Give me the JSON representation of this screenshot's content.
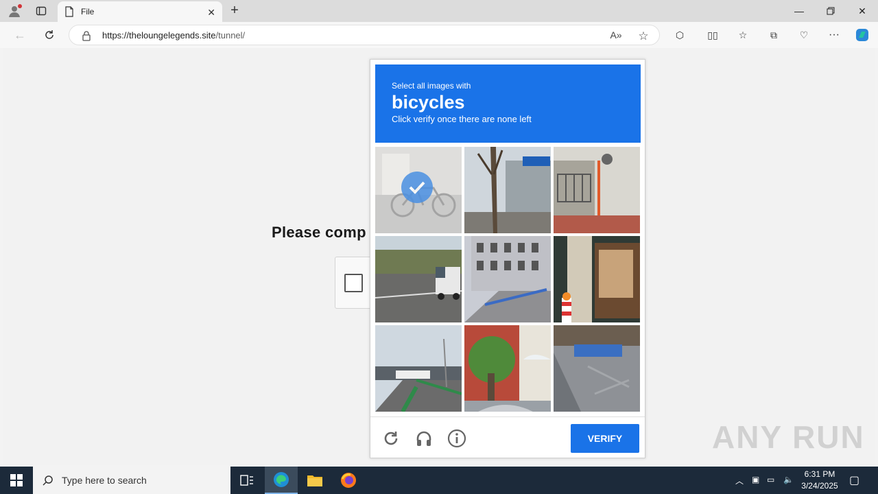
{
  "browser": {
    "tab_title": "File",
    "url_domain": "https://theloungelegends.site",
    "url_path": "/tunnel/"
  },
  "page": {
    "prompt_text": "Please comp"
  },
  "captcha": {
    "line1": "Select all images with",
    "target": "bicycles",
    "line3": "Click verify once there are none left",
    "verify_label": "VERIFY",
    "tiles": [
      {
        "scene": "bicycle",
        "selected": true
      },
      {
        "scene": "street-tree-awning",
        "selected": false
      },
      {
        "scene": "building-railing",
        "selected": false
      },
      {
        "scene": "highway-truck",
        "selected": false
      },
      {
        "scene": "building-facade",
        "selected": false
      },
      {
        "scene": "shop-window-pillar",
        "selected": false
      },
      {
        "scene": "bridge-road",
        "selected": false
      },
      {
        "scene": "hedge-storefront",
        "selected": false
      },
      {
        "scene": "asphalt-street",
        "selected": false
      }
    ],
    "accent": "#1a73e8"
  },
  "watermark": "ANY RUN",
  "taskbar": {
    "search_placeholder": "Type here to search",
    "time": "6:31 PM",
    "date": "3/24/2025"
  }
}
